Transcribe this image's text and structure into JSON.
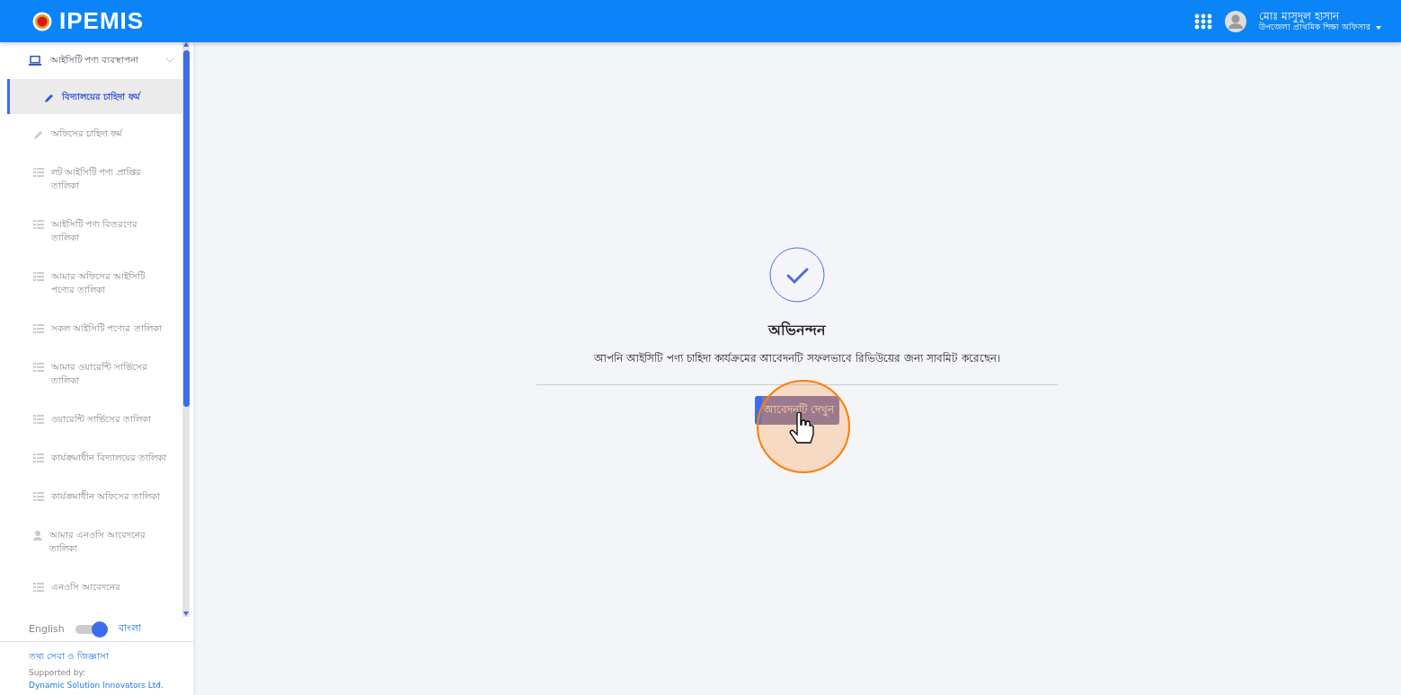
{
  "header": {
    "logo_text": "IPEMIS",
    "user_name": "মোঃ মাসুদুল হাসান",
    "user_role": "উপজেলা প্রাথমিক শিক্ষা অফিসার"
  },
  "sidebar": {
    "group": {
      "label": "আইসিটি পণ্য ব্যবস্থাপনা",
      "expanded": true
    },
    "items": [
      {
        "label": "বিদ্যালয়ের চাহিদা ফর্ম",
        "kind": "pencil",
        "selected": true
      },
      {
        "label": "অফিসের চাহিদা ফর্ম",
        "kind": "pencil",
        "selected": false
      },
      {
        "label": "লট আইসিটি পণ্য প্রাপ্তির তালিকা",
        "kind": "list",
        "selected": false
      },
      {
        "label": "আইসিটি পণ্য বিতরণের তালিকা",
        "kind": "list",
        "selected": false
      },
      {
        "label": "আমার অফিসের আইসিটি পণ্যের তালিকা",
        "kind": "list",
        "selected": false
      },
      {
        "label": "সকল আইসিটি পণ্যের তালিকা",
        "kind": "list",
        "selected": false
      },
      {
        "label": "আমার ওয়ারেন্টি সার্ভিসের তালিকা",
        "kind": "list",
        "selected": false
      },
      {
        "label": "ওয়ারেন্টি সার্ভিসের তালিকা",
        "kind": "list",
        "selected": false
      },
      {
        "label": "কার্যক্রমাধীন বিদ্যালয়ের তালিকা",
        "kind": "list",
        "selected": false
      },
      {
        "label": "কার্যক্রমাধীন অফিসের তালিকা",
        "kind": "list",
        "selected": false
      },
      {
        "label": "আমার এনওসি আবেদনের তালিকা",
        "kind": "user",
        "selected": false
      },
      {
        "label": "এনওসি আবেদনের",
        "kind": "list",
        "selected": false
      }
    ],
    "language": {
      "left": "English",
      "right": "বাংলা",
      "on": true
    },
    "help_link": "তথ্য সেবা ও জিজ্ঞাসা",
    "supported_by": "Supported by:",
    "company": "Dynamic Solution Innovators Ltd."
  },
  "success": {
    "title": "অভিনন্দন",
    "message": "আপনি আইসিটি পণ্য চাহিদা কার্যক্রমের আবেদনটি সফলভাবে রিভিউয়ের জন্য সাবমিট করেছেন।",
    "button": "আবেদনটি দেখুন"
  }
}
